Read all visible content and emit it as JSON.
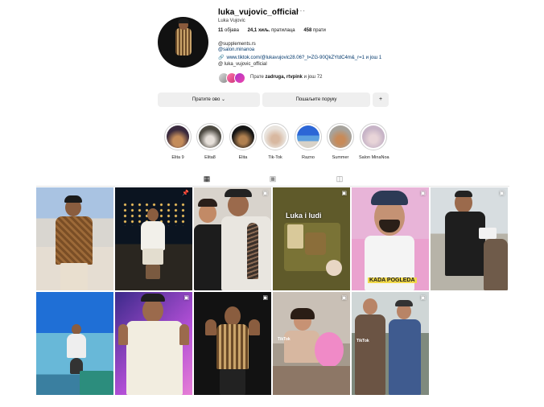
{
  "profile": {
    "username": "luka_vujovic_official",
    "more_icon": "more-horizontal-icon",
    "full_name": "Luka Vujovic",
    "stats": {
      "posts_value": "11",
      "posts_label": "објава",
      "followers_value": "24,1 хиљ.",
      "followers_label": "пратилаца",
      "following_value": "458",
      "following_label": "прати"
    },
    "bio_line1": "@supplements.rs",
    "bio_line2": "@salon.minanoa",
    "link_text": "www.tiktok.com/@lukavujovic28.06?_t=ZG-90QkZYtdC4m&_r=1 и још 1",
    "threads_text": "luka_vujovic_official",
    "followed_by_prefix": "Прате",
    "followed_by_names": "zadruga, rtvpink",
    "followed_by_suffix": "и још 72"
  },
  "actions": {
    "follow_label": "Пратите ово",
    "message_label": "Пошаљите поруку",
    "add_icon": "person-add-icon",
    "add_label": "+"
  },
  "highlights": [
    {
      "label": "Elita 9"
    },
    {
      "label": "Elita8"
    },
    {
      "label": "Elita"
    },
    {
      "label": "Tik-Tok"
    },
    {
      "label": "Razno"
    },
    {
      "label": "Summer"
    },
    {
      "label": "Salon MinaNoa"
    }
  ],
  "tabs": [
    {
      "icon": "grid-icon",
      "active": true
    },
    {
      "icon": "reels-icon",
      "active": false
    },
    {
      "icon": "tagged-icon",
      "active": false
    }
  ],
  "posts": [
    {
      "badge_icon": "none",
      "overlay": ""
    },
    {
      "badge_icon": "pin-icon",
      "overlay": ""
    },
    {
      "badge_icon": "reel-icon",
      "overlay": ""
    },
    {
      "badge_icon": "reel-icon",
      "overlay": "Luka  i ludi"
    },
    {
      "badge_icon": "reel-icon",
      "overlay": "KADA POGLEDA"
    },
    {
      "badge_icon": "reel-icon",
      "overlay": ""
    },
    {
      "badge_icon": "none",
      "overlay": ""
    },
    {
      "badge_icon": "reel-icon",
      "overlay": ""
    },
    {
      "badge_icon": "reel-icon",
      "overlay": ""
    },
    {
      "badge_icon": "reel-icon",
      "overlay": "TikTok"
    },
    {
      "badge_icon": "reel-icon",
      "overlay": "TikTok"
    }
  ]
}
